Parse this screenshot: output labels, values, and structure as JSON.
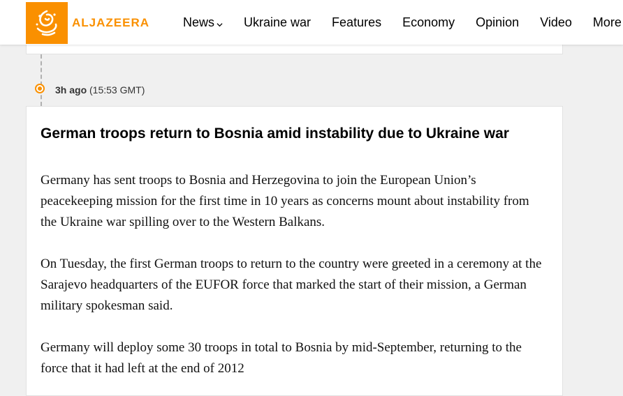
{
  "brand": {
    "name": "ALJAZEERA",
    "color": "#fa9000"
  },
  "nav": {
    "items": [
      {
        "label": "News",
        "has_dropdown": true,
        "icon": "chevron-down-icon"
      },
      {
        "label": "Ukraine war"
      },
      {
        "label": "Features"
      },
      {
        "label": "Economy"
      },
      {
        "label": "Opinion"
      },
      {
        "label": "Video"
      },
      {
        "label": "More"
      }
    ]
  },
  "timeline": {
    "ago": "3h ago",
    "time": "(15:53 GMT)"
  },
  "article": {
    "title": "German troops return to Bosnia amid instability due to Ukraine war",
    "paragraphs": [
      "Germany has sent troops to Bosnia and Herzegovina to join the European Union’s peacekeeping mission for the first time in 10 years as concerns mount about instability from the Ukraine war spilling over to the Western Balkans.",
      "On Tuesday, the first German troops to return to the country were greeted in a ceremony at the Sarajevo headquarters of the EUFOR force that marked the start of their mission, a German military spokesman said.",
      "Germany will deploy some 30 troops in total to Bosnia by mid-September, returning to the force that it had left at the end of 2012"
    ]
  }
}
